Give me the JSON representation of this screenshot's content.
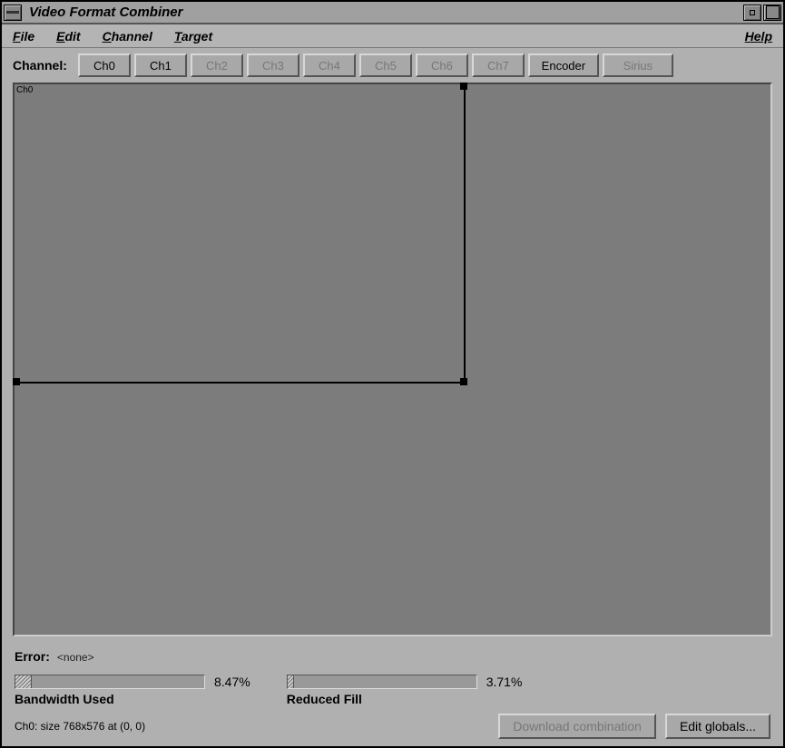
{
  "window": {
    "title": "Video Format Combiner"
  },
  "menubar": {
    "items": [
      "File",
      "Edit",
      "Channel",
      "Target"
    ],
    "help": "Help"
  },
  "toolbar": {
    "label": "Channel:",
    "channels": [
      "Ch0",
      "Ch1",
      "Ch2",
      "Ch3",
      "Ch4",
      "Ch5",
      "Ch6",
      "Ch7"
    ],
    "encoder": "Encoder",
    "sirius": "Sirius"
  },
  "canvas": {
    "region_label": "Ch0"
  },
  "error": {
    "label": "Error:",
    "value": "<none>"
  },
  "meters": {
    "bandwidth": {
      "label": "Bandwidth Used",
      "pct_text": "8.47%",
      "pct": 8.47
    },
    "reduced": {
      "label": "Reduced Fill",
      "pct_text": "3.71%",
      "pct": 3.71
    }
  },
  "status": "Ch0: size 768x576 at (0, 0)",
  "actions": {
    "download": "Download combination",
    "edit_globals": "Edit globals..."
  }
}
